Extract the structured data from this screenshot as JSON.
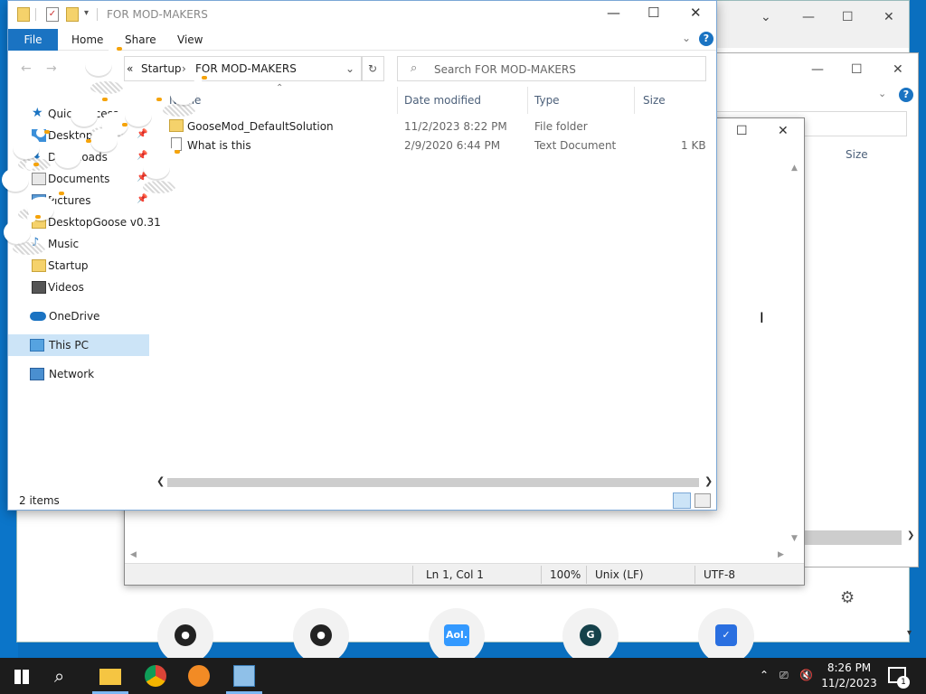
{
  "explorer": {
    "title": "FOR MOD-MAKERS",
    "ribbon": {
      "file": "File",
      "home": "Home",
      "share": "Share",
      "view": "View"
    },
    "breadcrumb": {
      "parent": "Startup",
      "current": "FOR MOD-MAKERS"
    },
    "search_placeholder": "Search FOR MOD-MAKERS",
    "columns": {
      "name": "Name",
      "date": "Date modified",
      "type": "Type",
      "size": "Size"
    },
    "files": [
      {
        "name": "GooseMod_DefaultSolution",
        "date": "11/2/2023 8:22 PM",
        "type": "File folder",
        "size": ""
      },
      {
        "name": "What is this",
        "date": "2/9/2020 6:44 PM",
        "type": "Text Document",
        "size": "1 KB"
      }
    ],
    "nav": {
      "quick_access": "Quick access",
      "desktop": "Desktop",
      "downloads": "Downloads",
      "documents": "Documents",
      "pictures": "Pictures",
      "desktopgoose": "DesktopGoose v0.31",
      "music": "Music",
      "startup": "Startup",
      "videos": "Videos",
      "onedrive": "OneDrive",
      "thispc": "This PC",
      "network": "Network"
    },
    "status": "2 items"
  },
  "notepad": {
    "position": "Ln 1, Col 1",
    "zoom": "100%",
    "line_ending": "Unix (LF)",
    "encoding": "UTF-8"
  },
  "exp2": {
    "size_col": "Size"
  },
  "shortcuts": [
    {
      "label": "",
      "icon": "github-icon",
      "color": "#222222"
    },
    {
      "label": "",
      "icon": "github-icon",
      "color": "#222222"
    },
    {
      "label": "Aol.",
      "icon": "aol-icon",
      "color": "#3399ff"
    },
    {
      "label": "G",
      "icon": "grammarly-icon",
      "color": "#15c39a"
    },
    {
      "label": "",
      "icon": "shield-icon",
      "color": "#2a6fe0"
    }
  ],
  "taskbar": {
    "time": "8:26 PM",
    "date": "11/2/2023",
    "notifications": "1"
  }
}
